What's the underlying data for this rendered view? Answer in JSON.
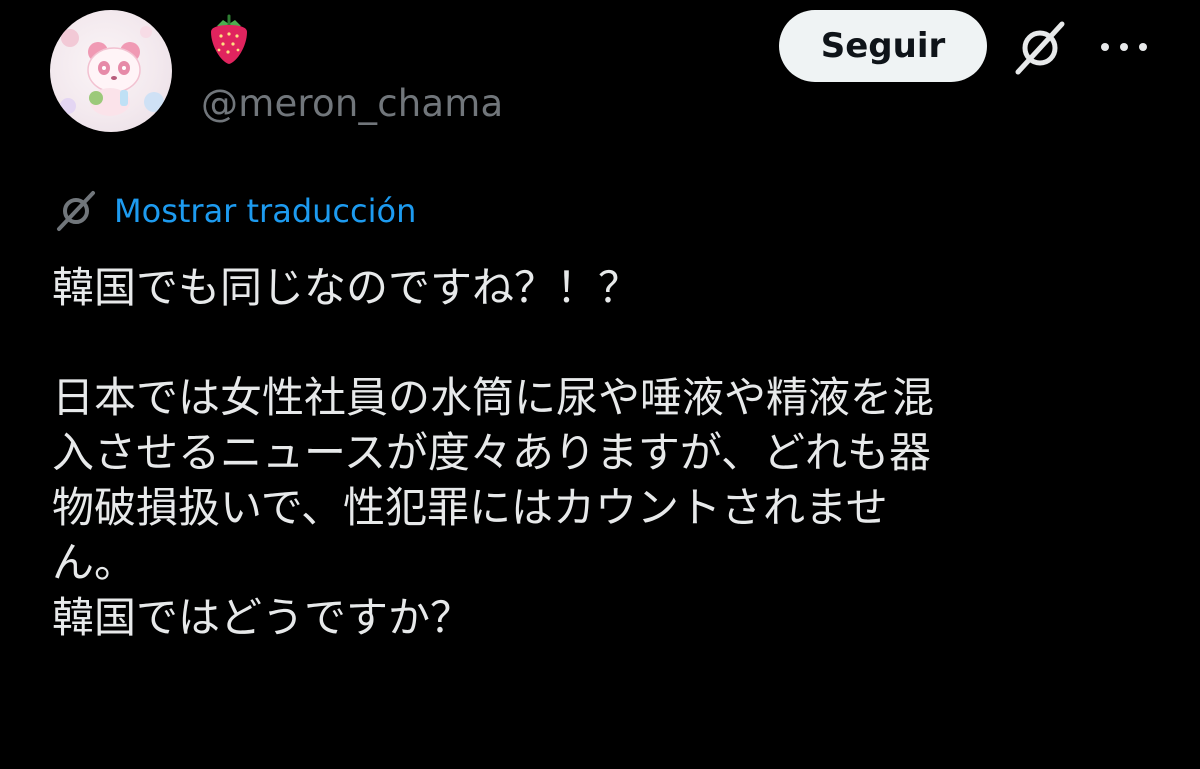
{
  "author": {
    "display_name_emoji": "strawberry-icon",
    "handle": "@meron_chama"
  },
  "actions": {
    "follow_label": "Seguir",
    "grok_icon": "grok-icon",
    "more_icon": "more-icon"
  },
  "translation": {
    "label": "Mostrar traducción",
    "icon": "grok-icon"
  },
  "tweet": {
    "paragraph1": "韓国でも同じなのですね？！？",
    "paragraph2": {
      "line1": "日本では女性社員の水筒に尿や唾液や精液を混",
      "line2": "入させるニュースが度々ありますが、どれも器",
      "line3": "物破損扱いで、性犯罪にはカウントされませ",
      "line4": "ん。",
      "line5": "韓国ではどうですか？"
    }
  },
  "colors": {
    "background": "#000000",
    "text_primary": "#e7e9ea",
    "text_secondary": "#71767b",
    "link": "#1d9bf0",
    "follow_bg": "#eff3f4",
    "follow_text": "#0f1419"
  }
}
